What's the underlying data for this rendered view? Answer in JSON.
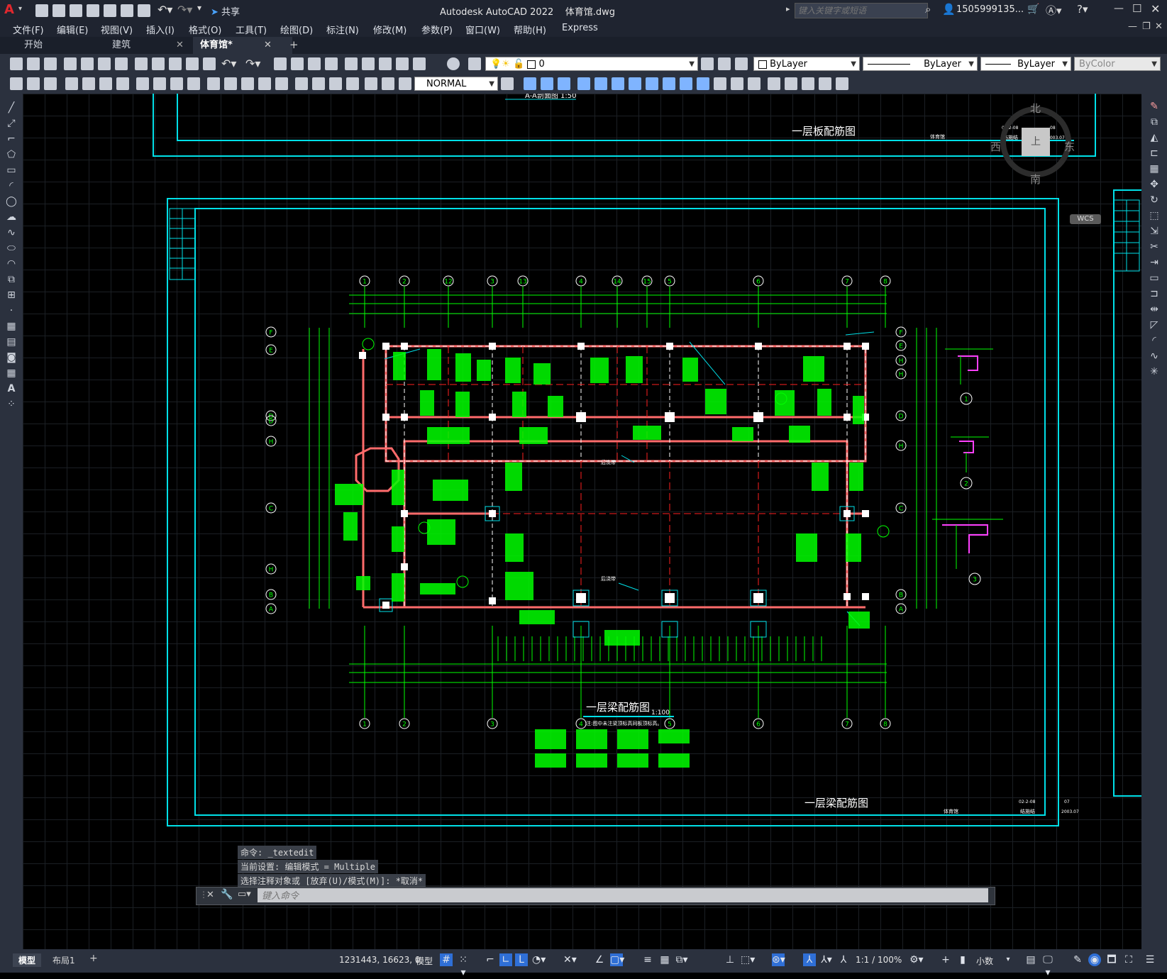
{
  "app": {
    "title": "Autodesk AutoCAD 2022",
    "filename": "体育馆.dwg",
    "search_placeholder": "键入关键字或短语",
    "user": "1505999135...",
    "share_label": "共享"
  },
  "menu": [
    "文件(F)",
    "编辑(E)",
    "视图(V)",
    "插入(I)",
    "格式(O)",
    "工具(T)",
    "绘图(D)",
    "标注(N)",
    "修改(M)",
    "参数(P)",
    "窗口(W)",
    "帮助(H)",
    "Express"
  ],
  "tabs": [
    {
      "label": "开始"
    },
    {
      "label": "建筑"
    },
    {
      "label": "体育馆*"
    }
  ],
  "toolbar": {
    "layer_value": "0",
    "dim_style": "NORMAL",
    "color": "ByLayer",
    "linetype": "ByLayer",
    "lineweight": "ByLayer",
    "plotstyle": "ByColor"
  },
  "viewcube": {
    "north": "北",
    "south": "南",
    "east": "东",
    "west": "西",
    "top": "上",
    "wcs": "WCS"
  },
  "drawing": {
    "section_label": "A-A剖面图 1:50",
    "upper_title": "一层板配筋图",
    "upper_project": "体育馆",
    "upper_code": "02-2-08",
    "upper_sheet": "08",
    "upper_designer": "结施结",
    "upper_date": "2003.07",
    "main_title": "一层梁配筋图",
    "main_scale": "1:100",
    "main_note": "注:图中未注梁顶标高同板顶标高。",
    "frame_title": "一层梁配筋图",
    "frame_project": "体育馆",
    "frame_code": "02-2-08",
    "frame_sheet": "07",
    "frame_designer": "结施结",
    "frame_date": "2003.07",
    "axes_top": [
      "1",
      "2",
      "12",
      "3",
      "13",
      "4",
      "14",
      "15",
      "5",
      "6",
      "7",
      "8"
    ],
    "axes_bottom": [
      "1",
      "2",
      "3",
      "4",
      "5",
      "6",
      "7",
      "8"
    ],
    "axes_left": [
      "F",
      "E",
      "D",
      "D",
      "H",
      "C",
      "H",
      "B",
      "A"
    ],
    "axes_right": [
      "F",
      "E",
      "H",
      "H",
      "D",
      "H",
      "C",
      "B",
      "A"
    ],
    "details": [
      "1",
      "2",
      "3"
    ],
    "annotation_word": "后浇带"
  },
  "command": {
    "history": [
      "命令: _textedit",
      "当前设置: 编辑模式 = Multiple",
      "选择注释对象或 [放弃(U)/模式(M)]: *取消*"
    ],
    "prompt_placeholder": "键入命令"
  },
  "status": {
    "layout_tabs": [
      "模型",
      "布局1"
    ],
    "coords": "1231443, 16623, 0",
    "space": "模型",
    "scale": "1:1 / 100%",
    "units": "小数"
  }
}
